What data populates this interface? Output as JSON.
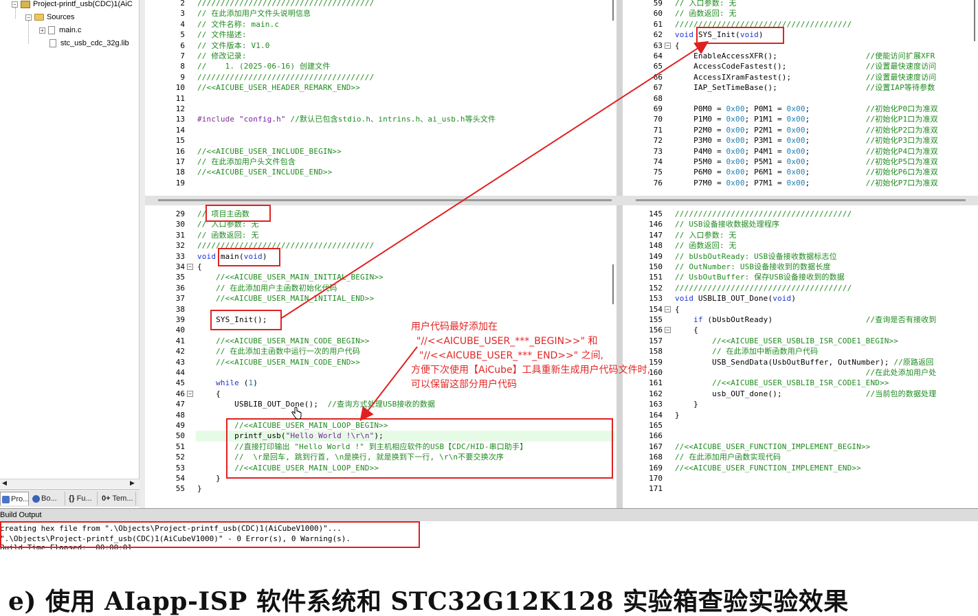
{
  "tree": {
    "project": "Project-printf_usb(CDC)1(AiC",
    "folder": "Sources",
    "files": [
      "main.c",
      "stc_usb_cdc_32g.lib"
    ]
  },
  "bottom_tabs": [
    "Pro...",
    "Bo...",
    "Fu...",
    "Tem..."
  ],
  "panes": {
    "top_left": [
      {
        "n": "2",
        "c": "//////////////////////////////////////",
        "t": "cm"
      },
      {
        "n": "3",
        "c": "// 在此添加用户文件头说明信息",
        "t": "cm"
      },
      {
        "n": "4",
        "c": "// 文件名称: main.c",
        "t": "cm"
      },
      {
        "n": "5",
        "c": "// 文件描述:",
        "t": "cm"
      },
      {
        "n": "6",
        "c": "// 文件版本: V1.0",
        "t": "cm"
      },
      {
        "n": "7",
        "c": "// 修改记录:",
        "t": "cm"
      },
      {
        "n": "8",
        "c": "//    1. (2025-06-16) 创建文件",
        "t": "cm"
      },
      {
        "n": "9",
        "c": "//////////////////////////////////////",
        "t": "cm"
      },
      {
        "n": "10",
        "c": "//<<AICUBE_USER_HEADER_REMARK_END>>",
        "t": "cm"
      },
      {
        "n": "11",
        "c": "",
        "t": ""
      },
      {
        "n": "12",
        "c": "",
        "t": ""
      },
      {
        "n": "13",
        "c": "#include \"config.h\" //默认已包含stdio.h、intrins.h、ai_usb.h等头文件",
        "t": "include"
      },
      {
        "n": "14",
        "c": "",
        "t": ""
      },
      {
        "n": "15",
        "c": "",
        "t": ""
      },
      {
        "n": "16",
        "c": "//<<AICUBE_USER_INCLUDE_BEGIN>>",
        "t": "cm"
      },
      {
        "n": "17",
        "c": "// 在此添加用户头文件包含",
        "t": "cm"
      },
      {
        "n": "18",
        "c": "//<<AICUBE_USER_INCLUDE_END>>",
        "t": "cm"
      },
      {
        "n": "19",
        "c": "",
        "t": ""
      }
    ],
    "top_right": [
      {
        "n": "59",
        "c": "// 入口参数: 无",
        "t": "cm"
      },
      {
        "n": "60",
        "c": "// 函数返回: 无",
        "t": "cm"
      },
      {
        "n": "61",
        "c": "//////////////////////////////////////",
        "t": "cm"
      },
      {
        "n": "62",
        "c": "void SYS_Init(void)",
        "t": "func"
      },
      {
        "n": "63",
        "c": "{",
        "t": "fold"
      },
      {
        "n": "64",
        "c": "    EnableAccessXFR();                   //使能访问扩展XFR",
        "t": "stmt"
      },
      {
        "n": "65",
        "c": "    AccessCodeFastest();                 //设置最快速度访问",
        "t": "stmt"
      },
      {
        "n": "66",
        "c": "    AccessIXramFastest();                //设置最快速度访问",
        "t": "stmt"
      },
      {
        "n": "67",
        "c": "    IAP_SetTimeBase();                   //设置IAP等待参数",
        "t": "stmt"
      },
      {
        "n": "68",
        "c": "",
        "t": ""
      },
      {
        "n": "69",
        "c": "    P0M0 = 0x00; P0M1 = 0x00;            //初始化P0口为准双",
        "t": "port"
      },
      {
        "n": "70",
        "c": "    P1M0 = 0x00; P1M1 = 0x00;            //初始化P1口为准双",
        "t": "port"
      },
      {
        "n": "71",
        "c": "    P2M0 = 0x00; P2M1 = 0x00;            //初始化P2口为准双",
        "t": "port"
      },
      {
        "n": "72",
        "c": "    P3M0 = 0x00; P3M1 = 0x00;            //初始化P3口为准双",
        "t": "port"
      },
      {
        "n": "73",
        "c": "    P4M0 = 0x00; P4M1 = 0x00;            //初始化P4口为准双",
        "t": "port"
      },
      {
        "n": "74",
        "c": "    P5M0 = 0x00; P5M1 = 0x00;            //初始化P5口为准双",
        "t": "port"
      },
      {
        "n": "75",
        "c": "    P6M0 = 0x00; P6M1 = 0x00;            //初始化P6口为准双",
        "t": "port"
      },
      {
        "n": "76",
        "c": "    P7M0 = 0x00; P7M1 = 0x00;            //初始化P7口为准双",
        "t": "port"
      }
    ],
    "bottom_left": [
      {
        "n": "29",
        "c": "// 项目主函数",
        "t": "cm"
      },
      {
        "n": "30",
        "c": "// 入口参数: 无",
        "t": "cm"
      },
      {
        "n": "31",
        "c": "// 函数返回: 无",
        "t": "cm"
      },
      {
        "n": "32",
        "c": "//////////////////////////////////////",
        "t": "cm"
      },
      {
        "n": "33",
        "c": "void main(void)",
        "t": "func"
      },
      {
        "n": "34",
        "c": "{",
        "t": "fold"
      },
      {
        "n": "35",
        "c": "    //<<AICUBE_USER_MAIN_INITIAL_BEGIN>>",
        "t": "cm"
      },
      {
        "n": "36",
        "c": "    // 在此添加用户主函数初始化代码",
        "t": "cm"
      },
      {
        "n": "37",
        "c": "    //<<AICUBE_USER_MAIN_INITIAL_END>>",
        "t": "cm"
      },
      {
        "n": "38",
        "c": "",
        "t": ""
      },
      {
        "n": "39",
        "c": "    SYS_Init();",
        "t": "stmt"
      },
      {
        "n": "40",
        "c": "",
        "t": ""
      },
      {
        "n": "41",
        "c": "    //<<AICUBE_USER_MAIN_CODE_BEGIN>>",
        "t": "cm"
      },
      {
        "n": "42",
        "c": "    // 在此添加主函数中运行一次的用户代码",
        "t": "cm"
      },
      {
        "n": "43",
        "c": "    //<<AICUBE_USER_MAIN_CODE_END>>",
        "t": "cm"
      },
      {
        "n": "44",
        "c": "",
        "t": ""
      },
      {
        "n": "45",
        "c": "    while (1)",
        "t": "while"
      },
      {
        "n": "46",
        "c": "    {",
        "t": "fold"
      },
      {
        "n": "47",
        "c": "        USBLIB_OUT_Done();  //查询方式处理USB接收的数据",
        "t": "stmtcm"
      },
      {
        "n": "48",
        "c": "",
        "t": ""
      },
      {
        "n": "49",
        "c": "        //<<AICUBE_USER_MAIN_LOOP_BEGIN>>",
        "t": "cm"
      },
      {
        "n": "50",
        "c": "        printf_usb(\"Hello World !\\r\\n\");",
        "t": "printf"
      },
      {
        "n": "51",
        "c": "        //直接打印输出 \"Hello World !\" 到主机相应软件的USB【CDC/HID-串口助手】",
        "t": "cm"
      },
      {
        "n": "52",
        "c": "        //  \\r是回车, 跳到行首, \\n是换行, 就是换到下一行, \\r\\n不要交换次序",
        "t": "cm"
      },
      {
        "n": "53",
        "c": "        //<<AICUBE_USER_MAIN_LOOP_END>>",
        "t": "cm"
      },
      {
        "n": "54",
        "c": "    }",
        "t": "stmt"
      },
      {
        "n": "55",
        "c": "}",
        "t": "stmt"
      }
    ],
    "bottom_right": [
      {
        "n": "145",
        "c": "//////////////////////////////////////",
        "t": "cm"
      },
      {
        "n": "146",
        "c": "// USB设备接收数据处理程序",
        "t": "cm"
      },
      {
        "n": "147",
        "c": "// 入口参数: 无",
        "t": "cm"
      },
      {
        "n": "148",
        "c": "// 函数返回: 无",
        "t": "cm"
      },
      {
        "n": "149",
        "c": "// bUsbOutReady: USB设备接收数据标志位",
        "t": "cm"
      },
      {
        "n": "150",
        "c": "// OutNumber: USB设备接收到的数据长度",
        "t": "cm"
      },
      {
        "n": "151",
        "c": "// UsbOutBuffer: 保存USB设备接收到的数据",
        "t": "cm"
      },
      {
        "n": "152",
        "c": "//////////////////////////////////////",
        "t": "cm"
      },
      {
        "n": "153",
        "c": "void USBLIB_OUT_Done(void)",
        "t": "func"
      },
      {
        "n": "154",
        "c": "{",
        "t": "fold"
      },
      {
        "n": "155",
        "c": "    if (bUsbOutReady)                    //查询是否有接收到",
        "t": "if"
      },
      {
        "n": "156",
        "c": "    {",
        "t": "fold"
      },
      {
        "n": "157",
        "c": "        //<<AICUBE_USER_USBLIB_ISR_CODE1_BEGIN>>",
        "t": "cm"
      },
      {
        "n": "158",
        "c": "        // 在此添加中断函数用户代码",
        "t": "cm"
      },
      {
        "n": "159",
        "c": "        USB_SendData(UsbOutBuffer, OutNumber); //原路返回",
        "t": "stmtcm"
      },
      {
        "n": "160",
        "c": "                                         //在此处添加用户处",
        "t": "cm"
      },
      {
        "n": "161",
        "c": "        //<<AICUBE_USER_USBLIB_ISR_CODE1_END>>",
        "t": "cm"
      },
      {
        "n": "162",
        "c": "        usb_OUT_done();                  //当前包的数据处理",
        "t": "stmtcm"
      },
      {
        "n": "163",
        "c": "    }",
        "t": "stmt"
      },
      {
        "n": "164",
        "c": "}",
        "t": "stmt"
      },
      {
        "n": "165",
        "c": "",
        "t": ""
      },
      {
        "n": "166",
        "c": "",
        "t": ""
      },
      {
        "n": "167",
        "c": "//<<AICUBE_USER_FUNCTION_IMPLEMENT_BEGIN>>",
        "t": "cm"
      },
      {
        "n": "168",
        "c": "// 在此添加用户函数实现代码",
        "t": "cm"
      },
      {
        "n": "169",
        "c": "//<<AICUBE_USER_FUNCTION_IMPLEMENT_END>>",
        "t": "cm"
      },
      {
        "n": "170",
        "c": "",
        "t": ""
      },
      {
        "n": "171",
        "c": "",
        "t": ""
      }
    ]
  },
  "annotation": {
    "lines": [
      "用户代码最好添加在",
      "\"//<<AICUBE_USER_***_BEGIN>>\" 和",
      "\"//<<AICUBE_USER_***_END>>\" 之间,",
      "方便下次使用【AiCube】工具重新生成用户代码文件时,",
      "可以保留这部分用户代码"
    ],
    "color": "#e32626"
  },
  "build_output": {
    "title": "Build Output",
    "lines": [
      "creating hex file from \".\\Objects\\Project-printf_usb(CDC)1(AiCubeV1000)\"...",
      "\".\\Objects\\Project-printf_usb(CDC)1(AiCubeV1000)\" - 0 Error(s), 0 Warning(s).",
      "Build Time Elapsed:  00:00:01"
    ]
  },
  "heading": "e)  使用 AIapp-ISP 软件系统和 STC32G12K128 实验箱查验实验效果",
  "colors": {
    "comment": "#1e8a1e",
    "keyword": "#1b36d6",
    "annotation": "#e02020"
  },
  "icons": [
    "project-icon",
    "folder-icon",
    "file-icon",
    "hand-cursor-icon"
  ]
}
